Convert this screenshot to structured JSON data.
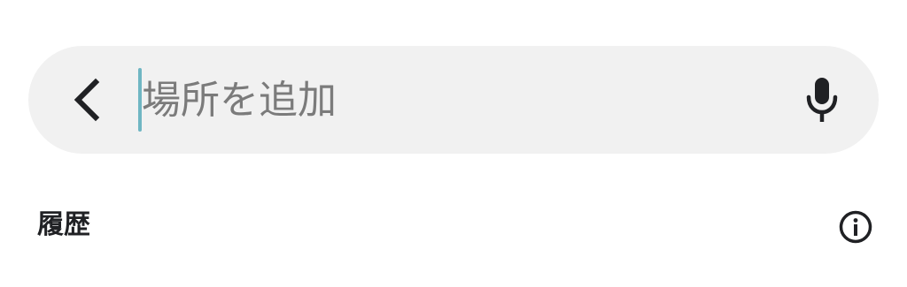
{
  "search": {
    "placeholder": "場所を追加",
    "value": "",
    "back_icon": "chevron-left-icon",
    "mic_icon": "microphone-icon"
  },
  "history": {
    "title": "履歴",
    "info_icon": "info-circle-icon"
  },
  "colors": {
    "search_bar_bg": "#f1f1f1",
    "caret": "#6fb6c3",
    "placeholder": "#7b7b7b",
    "icon": "#202124"
  }
}
